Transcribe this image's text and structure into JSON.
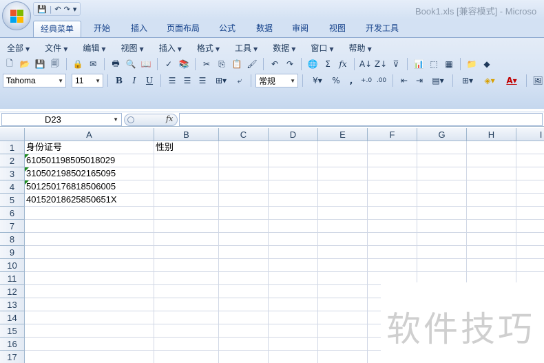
{
  "window": {
    "title": "Book1.xls  [兼容模式] - Microso"
  },
  "quick_access": {
    "save": "💾",
    "undo": "↶",
    "redo": "↷",
    "customize": "▾"
  },
  "ribbon_tabs": [
    "经典菜单",
    "开始",
    "插入",
    "页面布局",
    "公式",
    "数据",
    "审阅",
    "视图",
    "开发工具"
  ],
  "active_tab_index": 0,
  "classic_menu": [
    "全部",
    "文件",
    "编辑",
    "视图",
    "插入",
    "格式",
    "工具",
    "数据",
    "窗口",
    "帮助"
  ],
  "font": {
    "name": "Tahoma",
    "size": "11"
  },
  "format": {
    "bold": "B",
    "italic": "I",
    "underline": "U",
    "number_format": "常规",
    "percent": "%",
    "comma": ",",
    "inc_decimal": "+.0",
    "dec_decimal": ".00"
  },
  "autosum": "Σ",
  "function": "fx",
  "name_box": "D23",
  "formula_value": "",
  "fx_label": "fx",
  "columns": [
    "A",
    "B",
    "C",
    "D",
    "E",
    "F",
    "G",
    "H",
    "I"
  ],
  "rows": [
    "1",
    "2",
    "3",
    "4",
    "5",
    "6",
    "7",
    "8",
    "9",
    "10",
    "11",
    "12",
    "13",
    "14",
    "15",
    "16",
    "17"
  ],
  "cells": {
    "A1": "身份证号",
    "B1": "性别",
    "A2": "610501198505018029",
    "A3": "310502198502165095",
    "A4": "501250176818506005",
    "A5": "40152018625850651X"
  },
  "watermark": "软件技巧"
}
